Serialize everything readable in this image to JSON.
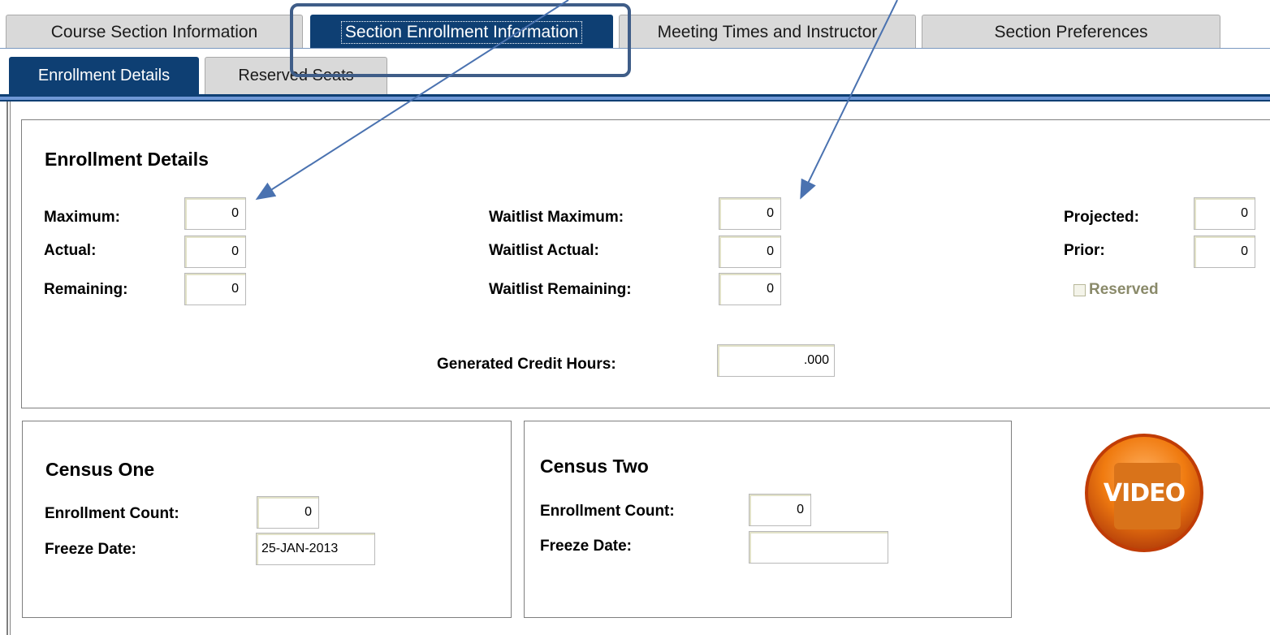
{
  "tabs": [
    {
      "label": "Course Section Information",
      "active": false
    },
    {
      "label": "Section Enrollment Information",
      "active": true
    },
    {
      "label": "Meeting Times and Instructor",
      "active": false
    },
    {
      "label": "Section Preferences",
      "active": false
    }
  ],
  "subtabs": [
    {
      "label": "Enrollment Details",
      "active": true
    },
    {
      "label": "Reserved Seats",
      "active": false
    }
  ],
  "enrollment": {
    "title": "Enrollment Details",
    "maximum_label": "Maximum:",
    "maximum": "0",
    "actual_label": "Actual:",
    "actual": "0",
    "remaining_label": "Remaining:",
    "remaining": "0",
    "wl_maximum_label": "Waitlist Maximum:",
    "wl_maximum": "0",
    "wl_actual_label": "Waitlist Actual:",
    "wl_actual": "0",
    "wl_remaining_label": "Waitlist Remaining:",
    "wl_remaining": "0",
    "projected_label": "Projected:",
    "projected": "0",
    "prior_label": "Prior:",
    "prior": "0",
    "reserved_label": "Reserved",
    "credit_hours_label": "Generated Credit Hours:",
    "credit_hours": ".000"
  },
  "census_one": {
    "title": "Census One",
    "count_label": "Enrollment Count:",
    "count": "0",
    "freeze_label": "Freeze Date:",
    "freeze": "25-JAN-2013"
  },
  "census_two": {
    "title": "Census Two",
    "count_label": "Enrollment Count:",
    "count": "0",
    "freeze_label": "Freeze Date:",
    "freeze": ""
  },
  "video": {
    "label": "VIDEO",
    "icon": "video-play-icon"
  },
  "colors": {
    "tab_active": "#0e3f73",
    "tab_inactive": "#d9d9d9",
    "annotation": "#4a72b0"
  }
}
